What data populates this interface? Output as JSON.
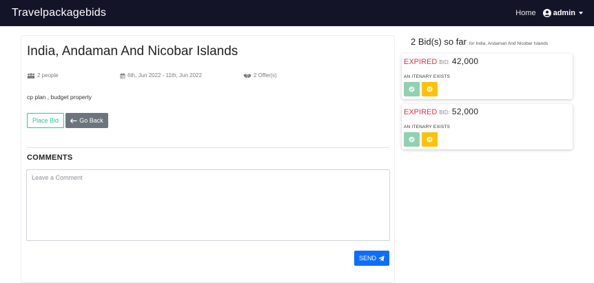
{
  "nav": {
    "brand": "Travelpackagebids",
    "home": "Home",
    "user": "admin"
  },
  "package": {
    "title": "India, Andaman And Nicobar Islands",
    "people": "2 people",
    "dates": "6th, Jun 2022 - 11th, Jun 2022",
    "offers": "2 Offer(s)",
    "description": "cp plan , budget property"
  },
  "actions": {
    "place_bid": "Place Bid",
    "go_back": "Go Back"
  },
  "comments": {
    "heading": "COMMENTS",
    "placeholder": "Leave a Comment",
    "send": "SEND"
  },
  "bids_panel": {
    "count_text": "2 Bid(s) so far",
    "for_text": "for India, Andaman And Nicobar Islands",
    "bids": [
      {
        "status": "EXPIRED",
        "label": "BID:",
        "amount": "42,000",
        "itinerary": "AN ITENARY EXISTS"
      },
      {
        "status": "EXPIRED",
        "label": "BID:",
        "amount": "52,000",
        "itinerary": "AN ITENARY EXISTS"
      }
    ]
  },
  "colors": {
    "navbar": "#141429",
    "expired": "#dc3545",
    "accept": "#8fd1b0",
    "pending": "#ffc107",
    "send": "#0d6efd",
    "place_bid": "#20c997"
  }
}
